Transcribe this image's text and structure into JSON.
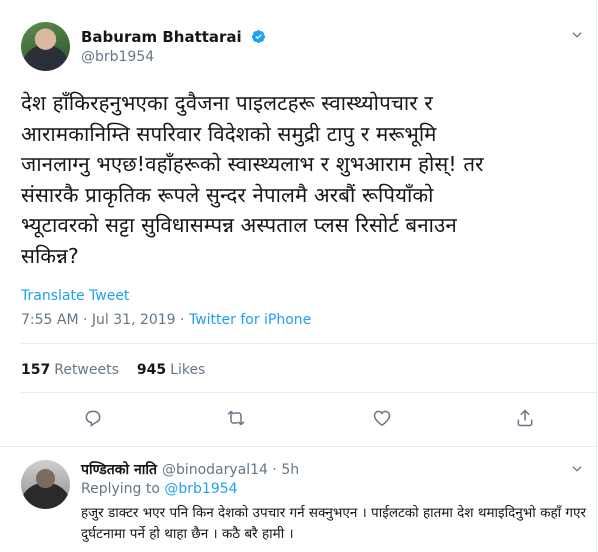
{
  "tweet": {
    "author_name": "Baburam Bhattarai",
    "handle": "@brb1954",
    "text": "देश हाँकिरहनुभएका दुवैजना पाइलटहरू स्वास्थ्योपचार र\nआरामकानिम्ति सपरिवार विदेशको समुद्री टापु र मरूभूमि\nजानलाग्नु भएछ!वहाँहरूको स्वास्थ्यलाभ र शुभआराम होस्! तर\nसंसारकै प्राकृतिक रूपले सुन्दर नेपालमै अरबौं रूपियाँको\nभ्यूटावरको सट्टा सुविधासम्पन्न अस्पताल प्लस रिसोर्ट बनाउन\nसकिन्न?",
    "translate_label": "Translate Tweet",
    "time": "7:55 AM",
    "date": "Jul 31, 2019",
    "client": "Twitter for iPhone",
    "retweets_count": "157",
    "retweets_label": "Retweets",
    "likes_count": "945",
    "likes_label": "Likes"
  },
  "reply": {
    "author_name": "पण्डितको नाति",
    "handle": "@binodaryal14",
    "age": "5h",
    "replying_label": "Replying to",
    "replying_to": "@brb1954",
    "text": "हजुर डाक्टर भएर पनि किन देशको उपचार गर्न सक्नुभएन । पाईलटको हातमा देश थमाइदिनुभो कहाँ गएर दुर्घटनामा पर्ने हो थाहा छैन । कठै बरै हामी ।"
  },
  "colors": {
    "accent": "#1da1f2",
    "secondary_text": "#657786",
    "divider": "#e6ecf0"
  },
  "icons": [
    "verified-badge-icon",
    "chevron-down-icon",
    "reply-icon",
    "retweet-icon",
    "like-icon",
    "share-icon"
  ]
}
